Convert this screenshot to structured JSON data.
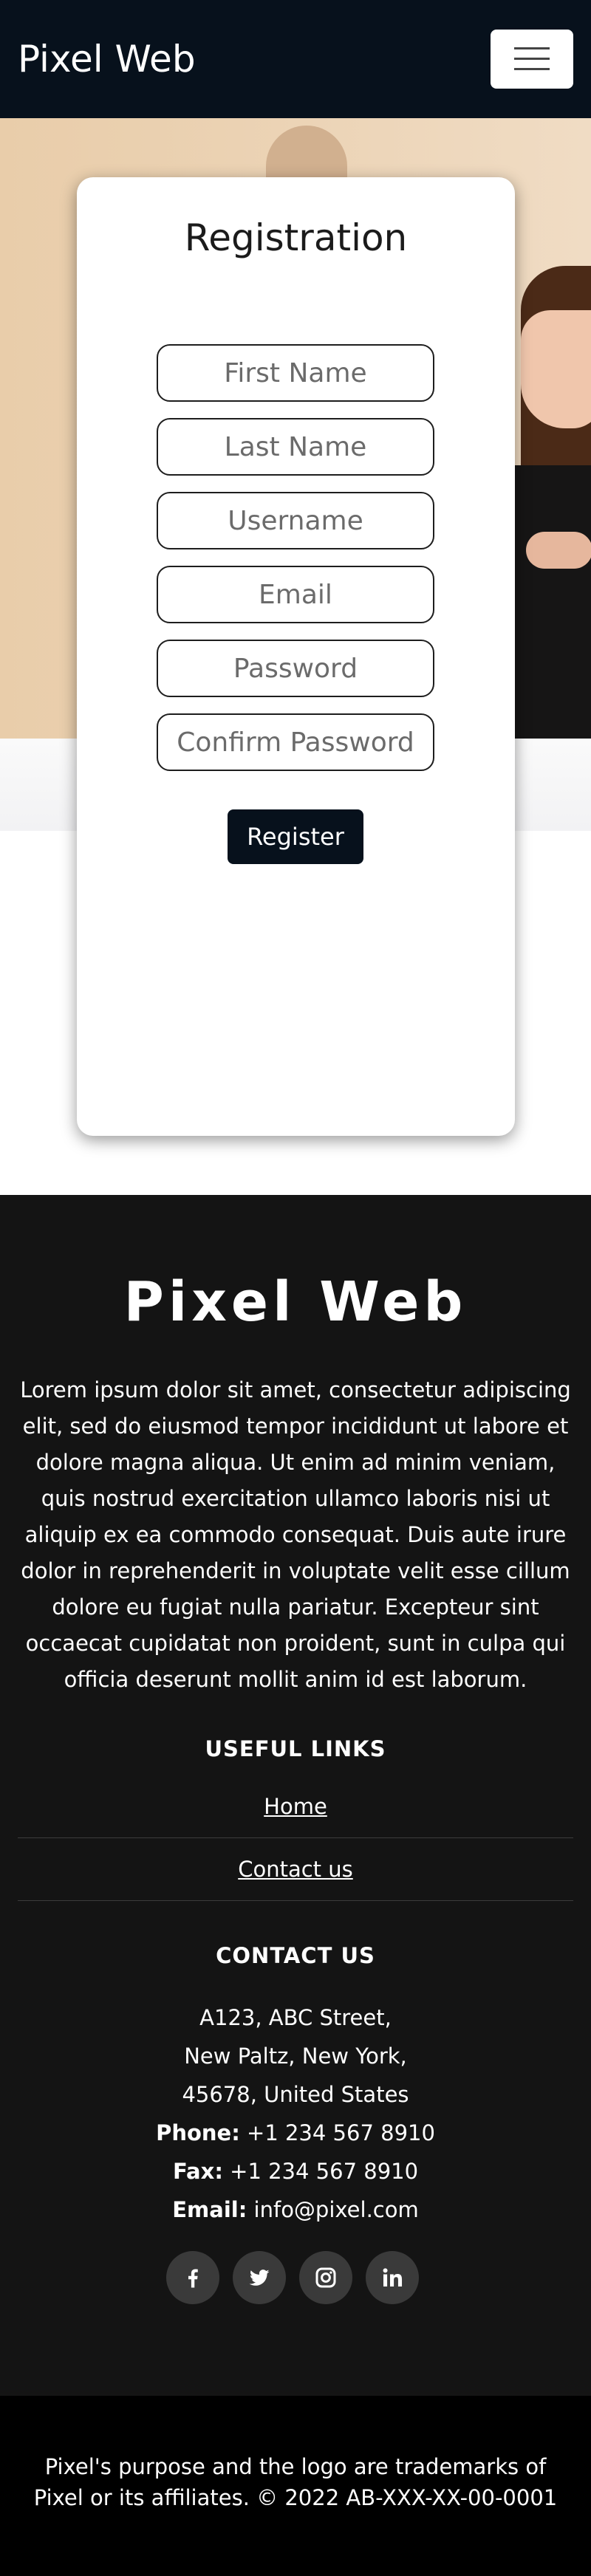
{
  "navbar": {
    "brand": "Pixel Web",
    "menu_icon": "hamburger-menu-icon"
  },
  "registration": {
    "title": "Registration",
    "fields": {
      "first_name": "First Name",
      "last_name": "Last Name",
      "username": "Username",
      "email": "Email",
      "password": "Password",
      "confirm_password": "Confirm Password"
    },
    "register_label": "Register"
  },
  "footer": {
    "brand": "Pixel Web",
    "description": "Lorem ipsum dolor sit amet, consectetur adipiscing elit, sed do eiusmod tempor incididunt ut labore et dolore magna aliqua. Ut enim ad minim veniam, quis nostrud exercitation ullamco laboris nisi ut aliquip ex ea commodo consequat. Duis aute irure dolor in reprehenderit in voluptate velit esse cillum dolore eu fugiat nulla pariatur. Excepteur sint occaecat cupidatat non proident, sunt in culpa qui officia deserunt mollit anim id est laborum.",
    "useful_links": {
      "heading": "USEFUL LINKS",
      "items": [
        "Home",
        "Contact us"
      ]
    },
    "contact": {
      "heading": "CONTACT US",
      "address": [
        "A123, ABC Street,",
        "New Paltz, New York,",
        "45678, United States"
      ],
      "phone_label": "Phone:",
      "phone": "+1 234 567 8910",
      "fax_label": "Fax:",
      "fax": "+1 234 567 8910",
      "email_label": "Email:",
      "email": "info@pixel.com"
    },
    "social": [
      "facebook-icon",
      "twitter-icon",
      "instagram-icon",
      "linkedin-icon"
    ]
  },
  "copyright": {
    "text": "Pixel's purpose and the logo are trademarks of Pixel or its affiliates. © 2022 AB-XXX-XX-00-0001"
  },
  "colors": {
    "navbar_bg": "#07111c",
    "footer_bg": "#141414",
    "copyright_bg": "#000000",
    "button_bg": "#07111c"
  }
}
